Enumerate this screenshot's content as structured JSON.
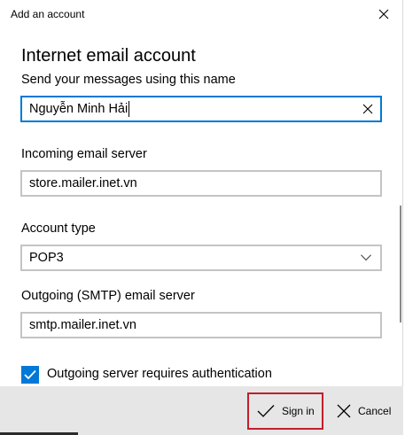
{
  "window": {
    "title": "Add an account"
  },
  "heading": "Internet email account",
  "name_field": {
    "label": "Send your messages using this name",
    "value": "Nguyễn Minh Hải"
  },
  "incoming_field": {
    "label": "Incoming email server",
    "value": "store.mailer.inet.vn"
  },
  "account_type": {
    "label": "Account type",
    "value": "POP3"
  },
  "outgoing_field": {
    "label": "Outgoing (SMTP) email server",
    "value": "smtp.mailer.inet.vn"
  },
  "auth_checkbox": {
    "label": "Outgoing server requires authentication",
    "checked": true
  },
  "footer": {
    "sign_in_label": "Sign in",
    "cancel_label": "Cancel"
  },
  "colors": {
    "accent": "#0078d7",
    "highlight": "#c0202a",
    "footer_bg": "#e6e6e6"
  },
  "icons": [
    "close-icon",
    "clear-icon",
    "chevron-down-icon",
    "checkmark-icon",
    "sign-in-check-icon",
    "cancel-x-icon"
  ]
}
